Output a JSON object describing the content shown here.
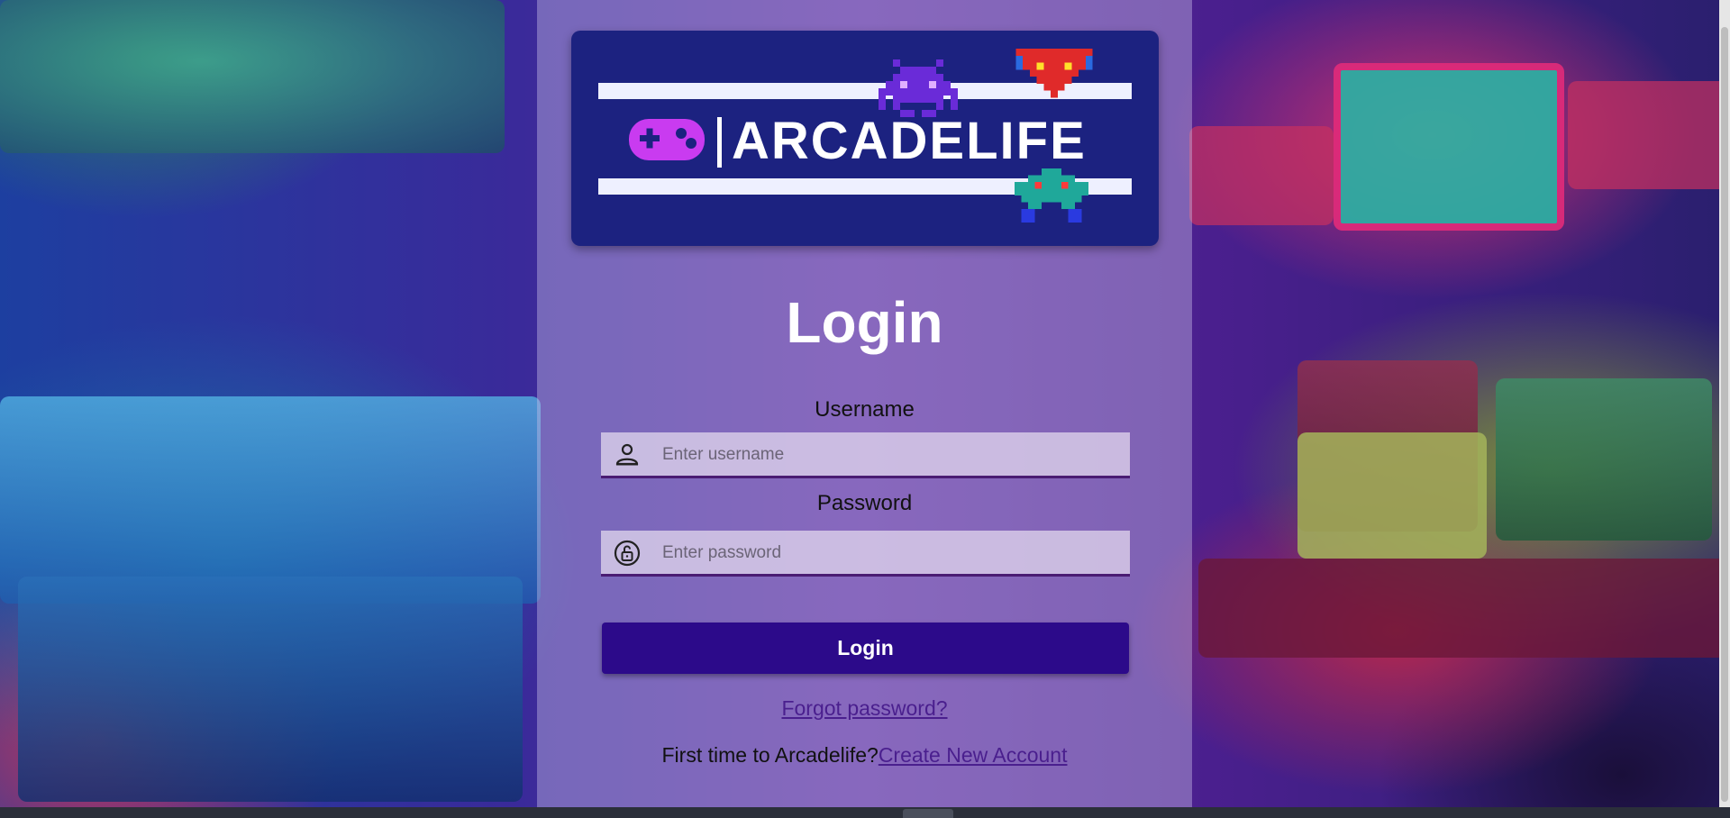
{
  "brand": {
    "name": "ARCADELIFE",
    "colors": {
      "card": "#1c2280",
      "accent": "#2c0a8a",
      "link": "#4a1f8e",
      "gamepad": "#c93bf0"
    }
  },
  "login": {
    "title": "Login",
    "username_label": "Username",
    "username_placeholder": "Enter username",
    "password_label": "Password",
    "password_placeholder": "Enter password",
    "submit_label": "Login",
    "forgot_label": "Forgot password?",
    "signup_prompt": "First time to Arcadelife?",
    "signup_link": "Create New Account"
  },
  "icons": {
    "username": "person-badge-icon",
    "password": "unlock-icon",
    "logo": "gamepad-icon"
  }
}
